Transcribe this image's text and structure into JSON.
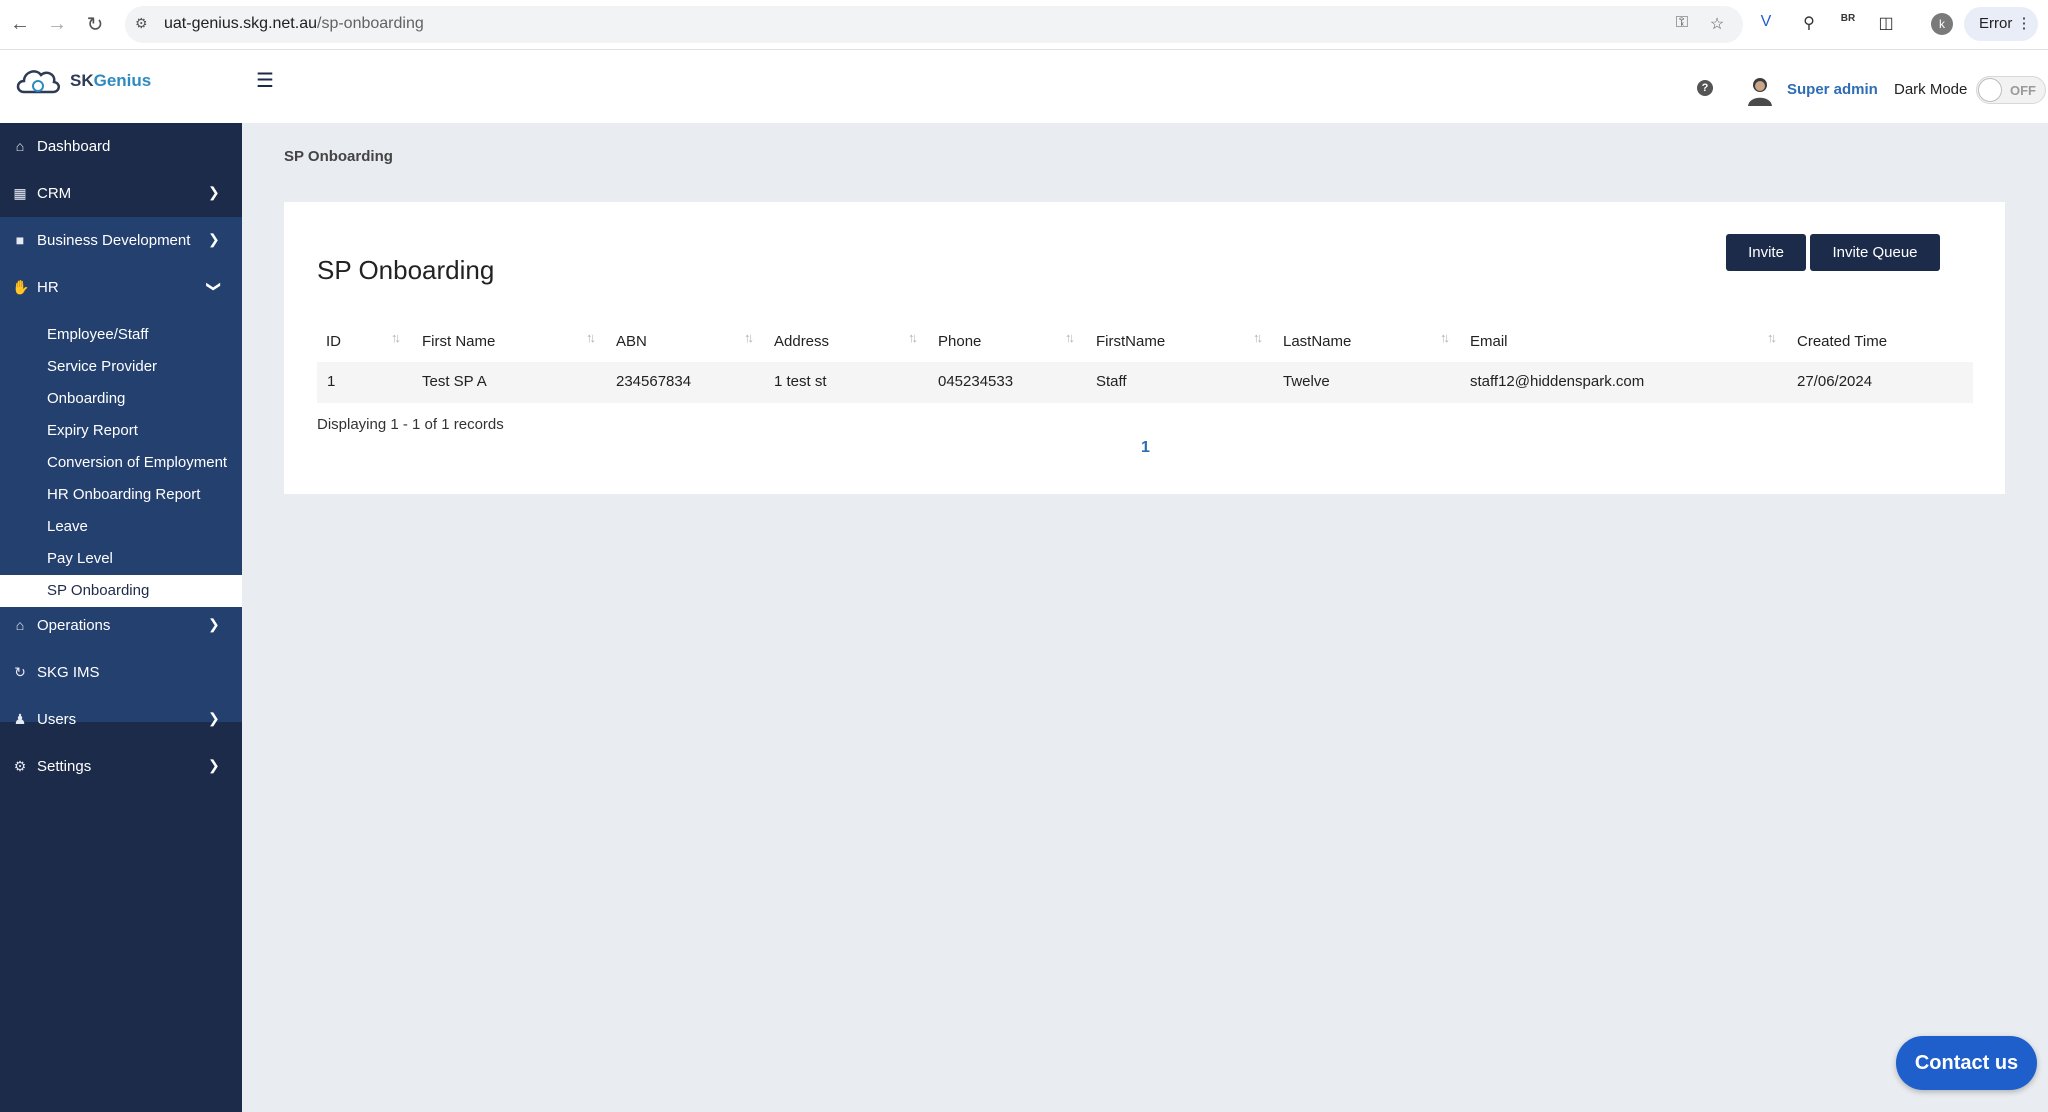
{
  "browser": {
    "url_host": "uat-genius.skg.net.au",
    "url_path": "/sp-onboarding",
    "profile_initial": "k",
    "error_label": "Error"
  },
  "header": {
    "brand_part1": "SK",
    "brand_part2": "Genius",
    "user_name": "Super admin",
    "dark_mode_label": "Dark Mode",
    "dark_mode_state": "OFF",
    "help_glyph": "?"
  },
  "sidebar": {
    "items": [
      {
        "label": "Dashboard",
        "icon": "home-icon"
      },
      {
        "label": "CRM",
        "icon": "building-icon"
      },
      {
        "label": "Business Development",
        "icon": "folder-icon"
      },
      {
        "label": "HR",
        "icon": "handshake-icon"
      },
      {
        "label": "Operations",
        "icon": "shop-icon"
      },
      {
        "label": "SKG IMS",
        "icon": "sync-icon"
      },
      {
        "label": "Users",
        "icon": "users-icon"
      },
      {
        "label": "Settings",
        "icon": "gear-icon"
      }
    ],
    "hr_sub": [
      "Employee/Staff",
      "Service Provider",
      "Onboarding",
      "Expiry Report",
      "Conversion of Employment",
      "HR Onboarding Report",
      "Leave",
      "Pay Level",
      "SP Onboarding"
    ]
  },
  "main": {
    "breadcrumb": "SP Onboarding",
    "title": "SP Onboarding",
    "invite_label": "Invite",
    "invite_queue_label": "Invite Queue",
    "columns": [
      "ID",
      "First Name",
      "ABN",
      "Address",
      "Phone",
      "FirstName",
      "LastName",
      "Email",
      "Created Time"
    ],
    "rows": [
      [
        "1",
        "Test SP A",
        "234567834",
        "1 test st",
        "045234533",
        "Staff",
        "Twelve",
        "staff12@hiddenspark.com",
        "27/06/2024"
      ]
    ],
    "records_text": "Displaying 1 - 1 of 1 records",
    "current_page": "1"
  },
  "contact_label": "Contact us"
}
